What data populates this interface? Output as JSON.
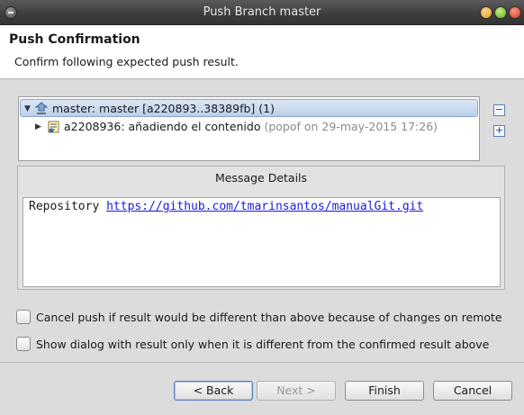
{
  "window": {
    "title": "Push Branch master"
  },
  "header": {
    "title": "Push Confirmation",
    "description": "Confirm following expected push result."
  },
  "tree": {
    "rows": [
      {
        "label": "master: master [a220893..38389fb] (1)"
      },
      {
        "label": "a2208936: añadiendo el contenido",
        "meta": "(popof on 29-may-2015 17:26)"
      }
    ],
    "collapse_label": "−",
    "expand_label": "+"
  },
  "message": {
    "group_title": "Message Details",
    "prefix": "Repository",
    "url": "https://github.com/tmarinsantos/manualGit.git"
  },
  "options": [
    {
      "label": "Cancel push if result would be different than above because of changes on remote",
      "checked": false
    },
    {
      "label": "Show dialog with result only when it is different from the confirmed result above",
      "checked": false
    }
  ],
  "buttons": {
    "back": "< Back",
    "next": "Next >",
    "finish": "Finish",
    "cancel": "Cancel"
  }
}
